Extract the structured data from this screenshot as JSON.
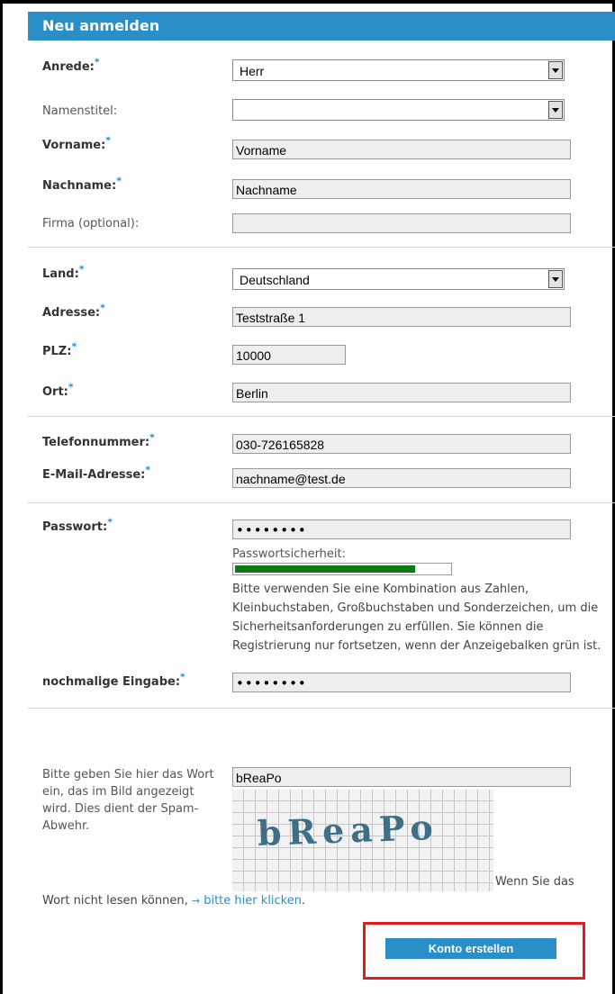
{
  "header": {
    "title": "Neu anmelden"
  },
  "required_marker": "*",
  "fields": {
    "salutation": {
      "label": "Anrede:",
      "value": "Herr"
    },
    "title": {
      "label": "Namenstitel:",
      "value": ""
    },
    "firstname": {
      "label": "Vorname:",
      "value": "Vorname"
    },
    "lastname": {
      "label": "Nachname:",
      "value": "Nachname"
    },
    "company": {
      "label": "Firma (optional):",
      "value": ""
    },
    "country": {
      "label": "Land:",
      "value": "Deutschland"
    },
    "address": {
      "label": "Adresse:",
      "value": "Teststraße 1"
    },
    "zip": {
      "label": "PLZ:",
      "value": "10000"
    },
    "city": {
      "label": "Ort:",
      "value": "Berlin"
    },
    "phone": {
      "label": "Telefonnummer:",
      "value": "030-726165828"
    },
    "email": {
      "label": "E-Mail-Adresse:",
      "value": "nachname@test.de"
    },
    "password": {
      "label": "Passwort:",
      "value": "••••••••"
    },
    "password_repeat": {
      "label": "nochmalige Eingabe:",
      "value": "••••••••"
    }
  },
  "password_strength": {
    "label": "Passwortsicherheit:",
    "fraction": 0.84,
    "color": "#0b7a12",
    "help": "Bitte verwenden Sie eine Kombination aus Zahlen, Kleinbuchstaben, Großbuchstaben und Sonderzeichen, um die Sicherheitsanforderungen zu erfüllen. Sie können die Registrierung nur fortsetzen, wenn der Anzeigebalken grün ist."
  },
  "captcha": {
    "instruction": "Bitte geben Sie hier das Wort ein, das im Bild angezeigt wird. Dies dient der Spam-Abwehr.",
    "value": "bReaPo",
    "image_text": "bReaPo",
    "hint_part1": "Wenn Sie das",
    "hint_part2": "Wort nicht lesen können,",
    "link_arrow": "→",
    "link_text": "bitte hier klicken",
    "link_suffix": "."
  },
  "submit": {
    "label": "Konto erstellen"
  },
  "colors": {
    "accent": "#2a8fc7",
    "highlight": "#e31b1b",
    "strength": "#0b7a12"
  }
}
